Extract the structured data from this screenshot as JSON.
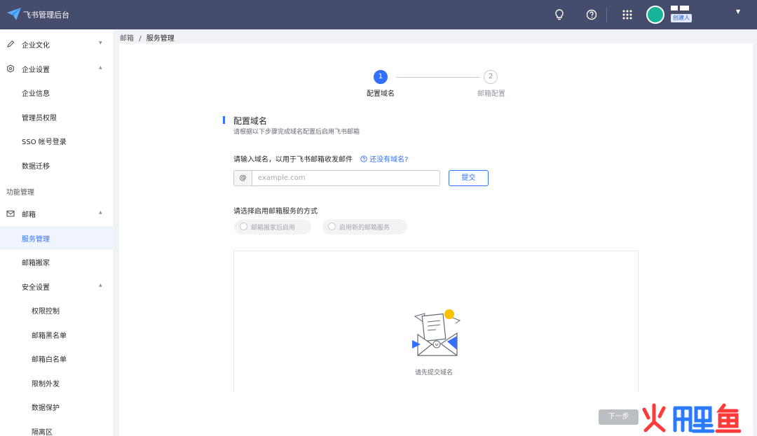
{
  "header": {
    "app_title": "飞书管理后台",
    "role_badge": "创建人",
    "icons": [
      "bulb-icon",
      "help-icon",
      "app-grid-icon",
      "caret-down-icon"
    ]
  },
  "sidebar": {
    "items": [
      {
        "label": "企业文化",
        "icon": "pencil-icon"
      },
      {
        "label": "企业设置",
        "icon": "gear-icon"
      },
      {
        "label": "企业信息"
      },
      {
        "label": "管理员权限"
      },
      {
        "label": "SSO 帐号登录"
      },
      {
        "label": "数据迁移"
      },
      {
        "label": "邮箱",
        "icon": "mail-icon"
      },
      {
        "label": "服务管理"
      },
      {
        "label": "邮箱搬家"
      },
      {
        "label": "安全设置"
      },
      {
        "label": "权限控制"
      },
      {
        "label": "邮箱黑名单"
      },
      {
        "label": "邮箱白名单"
      },
      {
        "label": "限制外发"
      },
      {
        "label": "数据保护"
      },
      {
        "label": "隔离区"
      }
    ],
    "section_label": "功能管理"
  },
  "breadcrumb": {
    "parent": "邮箱",
    "sep": "/",
    "current": "服务管理"
  },
  "steps": [
    {
      "num": "1",
      "label": "配置域名",
      "active": true
    },
    {
      "num": "2",
      "label": "邮箱配置",
      "active": false
    }
  ],
  "form": {
    "title": "配置域名",
    "desc": "请根据以下步骤完成域名配置后启用飞书邮箱",
    "domain_label": "请输入域名，以用于飞书邮箱收发邮件",
    "help_link": "还没有域名?",
    "at": "@",
    "placeholder": "example.com",
    "submit": "提交",
    "method_label": "请选择启用邮箱服务的方式",
    "options": [
      "邮箱搬家后启用",
      "启用新的邮箱服务"
    ],
    "empty_text": "请先提交域名",
    "next": "下一步"
  },
  "colors": {
    "topbar": "#464d6c",
    "accent": "#3370ff",
    "avatar": "#18b49a"
  }
}
